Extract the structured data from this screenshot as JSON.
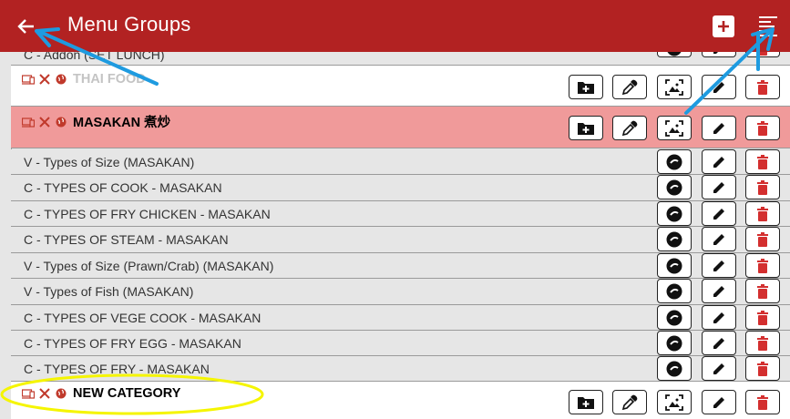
{
  "header": {
    "title": "Menu Groups",
    "bg_color": "#b22222",
    "back_icon": "arrow-left-icon",
    "add_icon": "plus-square-icon",
    "sort_icon": "sort-lines-icon"
  },
  "groups": [
    {
      "name": "THAI FOOD",
      "style": "faded"
    },
    {
      "name": "MASAKAN 煮炒",
      "style": "highlighted"
    },
    {
      "name": "NEW CATEGORY",
      "style": "normal"
    }
  ],
  "categories": {
    "partial_top": "C - Addon (SET LUNCH)",
    "items": [
      "V - Types of Size  (MASAKAN)",
      "C - TYPES OF COOK - MASAKAN",
      "C - TYPES OF FRY CHICKEN - MASAKAN",
      "C - TYPES OF STEAM - MASAKAN",
      "V - Types of Size (Prawn/Crab)  (MASAKAN)",
      "V - Types of Fish  (MASAKAN)",
      "C - TYPES OF VEGE COOK - MASAKAN",
      "C - TYPES OF FRY EGG - MASAKAN",
      "C - TYPES OF FRY - MASAKAN"
    ]
  },
  "colors": {
    "highlight": "#f09a9a",
    "delete": "#d32f2f",
    "annotation_arrow": "#1e9be0",
    "annotation_circle": "#f5f500"
  }
}
